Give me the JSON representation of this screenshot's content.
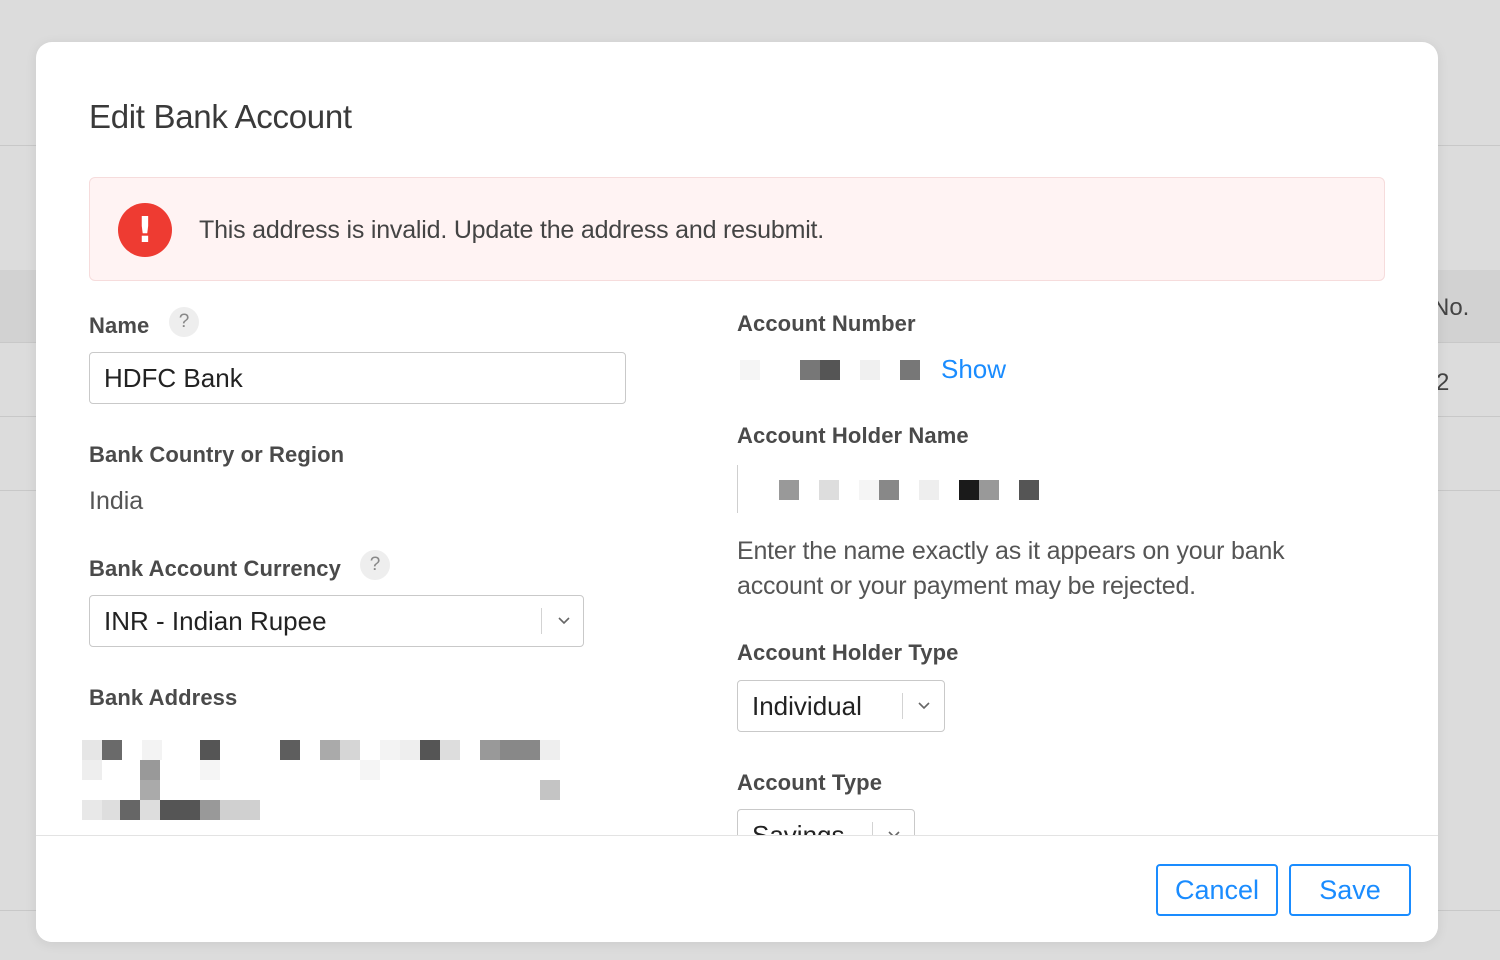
{
  "background": {
    "column_header_partial": "No.",
    "cell_partial": "2"
  },
  "dialog": {
    "title": "Edit Bank Account",
    "alert": {
      "icon": "exclamation-icon",
      "icon_glyph": "!",
      "message": "This address is invalid. Update the address and resubmit.",
      "color": "#ee3b32"
    },
    "left": {
      "name_label": "Name",
      "name_help": "?",
      "name_value": "HDFC Bank",
      "country_label": "Bank Country or Region",
      "country_value": "India",
      "currency_label": "Bank Account Currency",
      "currency_help": "?",
      "currency_value": "INR - Indian Rupee",
      "address_label": "Bank Address"
    },
    "right": {
      "account_number_label": "Account Number",
      "show_link": "Show",
      "holder_name_label": "Account Holder Name",
      "holder_name_hint": "Enter the name exactly as it appears on your bank account or your payment may be rejected.",
      "holder_type_label": "Account Holder Type",
      "holder_type_value": "Individual",
      "account_type_label": "Account Type",
      "account_type_value": "Savings"
    },
    "footer": {
      "cancel_label": "Cancel",
      "save_label": "Save"
    },
    "accent_color": "#1a8cff"
  }
}
